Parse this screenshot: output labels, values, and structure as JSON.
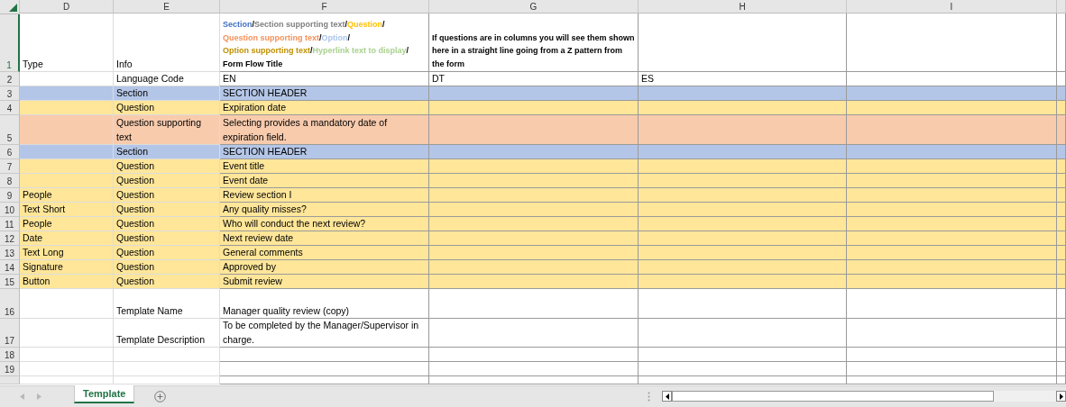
{
  "columns": [
    "D",
    "E",
    "F",
    "G",
    "H",
    "I"
  ],
  "rows": [
    {
      "number": "1",
      "kind": "plain",
      "selected": true,
      "cells": {
        "D": "Type",
        "E": "Info",
        "F": {
          "bold": true,
          "segments": [
            {
              "text": "Section",
              "color": "#4472c4"
            },
            {
              "text": "/"
            },
            {
              "text": "Section supporting text",
              "color": "#7f7f7f"
            },
            {
              "text": "/"
            },
            {
              "text": "Question",
              "color": "#ffc000"
            },
            {
              "text": "/"
            },
            {
              "text": "Question supporting text",
              "color": "#f4915a"
            },
            {
              "text": "/"
            },
            {
              "text": "Option",
              "color": "#a9c4eb"
            },
            {
              "text": "/"
            },
            {
              "text": "Option supporting text",
              "color": "#c09000"
            },
            {
              "text": "/"
            },
            {
              "text": "Hyperlink text to display",
              "color": "#a9d18e"
            },
            {
              "text": "/"
            },
            {
              "text": "Form Flow Title"
            }
          ]
        },
        "G": {
          "bold": true,
          "text": "If questions are in columns you will see them shown here in a straight line going from a Z pattern from the form"
        }
      }
    },
    {
      "number": "2",
      "kind": "plain",
      "selected": false,
      "cells": {
        "E": "Language Code",
        "F": "EN",
        "G": "DT",
        "H": "ES"
      }
    },
    {
      "number": "3",
      "kind": "section",
      "selected": false,
      "cells": {
        "E": "Section",
        "F": "SECTION HEADER"
      }
    },
    {
      "number": "4",
      "kind": "question",
      "selected": false,
      "cells": {
        "E": "Question",
        "F": "Expiration date"
      }
    },
    {
      "number": "5",
      "kind": "support",
      "selected": false,
      "cells": {
        "E": "Question supporting text",
        "F": "Selecting provides a mandatory date  of expiration field."
      }
    },
    {
      "number": "6",
      "kind": "section",
      "selected": false,
      "cells": {
        "E": "Section",
        "F": "SECTION HEADER"
      }
    },
    {
      "number": "7",
      "kind": "question",
      "selected": false,
      "cells": {
        "E": "Question",
        "F": "Event title"
      }
    },
    {
      "number": "8",
      "kind": "question",
      "selected": false,
      "cells": {
        "E": "Question",
        "F": "Event date"
      }
    },
    {
      "number": "9",
      "kind": "question",
      "selected": false,
      "cells": {
        "D": "People",
        "E": "Question",
        "F": "Review section I"
      }
    },
    {
      "number": "10",
      "kind": "question",
      "selected": false,
      "cells": {
        "D": "Text Short",
        "E": "Question",
        "F": "Any quality misses?"
      }
    },
    {
      "number": "11",
      "kind": "question",
      "selected": false,
      "cells": {
        "D": "People",
        "E": "Question",
        "F": "Who will conduct the next review?"
      }
    },
    {
      "number": "12",
      "kind": "question",
      "selected": false,
      "cells": {
        "D": "Date",
        "E": "Question",
        "F": "Next review date"
      }
    },
    {
      "number": "13",
      "kind": "question",
      "selected": false,
      "cells": {
        "D": "Text Long",
        "E": "Question",
        "F": "General comments"
      }
    },
    {
      "number": "14",
      "kind": "question",
      "selected": false,
      "cells": {
        "D": "Signature",
        "E": "Question",
        "F": "Approved by"
      }
    },
    {
      "number": "15",
      "kind": "question",
      "selected": false,
      "cells": {
        "D": "Button",
        "E": "Question",
        "F": "Submit review"
      }
    },
    {
      "number": "16",
      "kind": "plain",
      "selected": false,
      "cells": {
        "E": "Template Name",
        "F": "Manager quality review (copy)"
      }
    },
    {
      "number": "17",
      "kind": "plain",
      "selected": false,
      "cells": {
        "E": "Template Description",
        "F": "To be completed by the Manager/Supervisor in charge."
      }
    },
    {
      "number": "18",
      "kind": "plain",
      "selected": false
    },
    {
      "number": "19",
      "kind": "plain",
      "selected": false
    }
  ],
  "sheet_tabs": [
    {
      "label": "Template",
      "selected": true
    }
  ]
}
